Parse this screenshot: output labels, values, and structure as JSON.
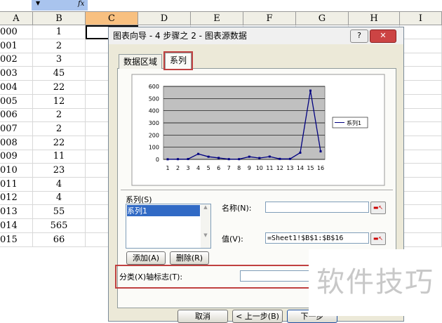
{
  "formula_bar": {
    "fx": "fx"
  },
  "columns": [
    "A",
    "B",
    "C",
    "D",
    "E",
    "F",
    "G",
    "H",
    "I"
  ],
  "rows": [
    [
      "000",
      "1"
    ],
    [
      "001",
      "2"
    ],
    [
      "002",
      "3"
    ],
    [
      "003",
      "45"
    ],
    [
      "004",
      "22"
    ],
    [
      "005",
      "12"
    ],
    [
      "006",
      "2"
    ],
    [
      "007",
      "2"
    ],
    [
      "008",
      "22"
    ],
    [
      "009",
      "11"
    ],
    [
      "010",
      "23"
    ],
    [
      "011",
      "4"
    ],
    [
      "012",
      "4"
    ],
    [
      "013",
      "55"
    ],
    [
      "014",
      "565"
    ],
    [
      "015",
      "66"
    ]
  ],
  "dialog": {
    "title": "图表向导 - 4 步骤之 2 - 图表源数据",
    "help": "?",
    "close": "✕",
    "tabs": [
      "数据区域",
      "系列"
    ],
    "series_label": "系列(S)",
    "series_items": [
      "系列1"
    ],
    "name_label": "名称(N):",
    "name_value": "",
    "value_label": "值(V):",
    "value_value": "=Sheet1!$B$1:$B$16",
    "add": "添加(A)",
    "delete": "删除(R)",
    "category_label": "分类(X)轴标志(T):",
    "category_value": "",
    "cancel": "取消",
    "back": "< 上一步(B)",
    "next": "下一步"
  },
  "chart_data": {
    "type": "line",
    "categories": [
      "1",
      "2",
      "3",
      "4",
      "5",
      "6",
      "7",
      "8",
      "9",
      "10",
      "11",
      "12",
      "13",
      "14",
      "15",
      "16"
    ],
    "series": [
      {
        "name": "系列1",
        "values": [
          1,
          2,
          3,
          45,
          22,
          12,
          2,
          2,
          22,
          11,
          23,
          4,
          4,
          55,
          565,
          66
        ]
      }
    ],
    "yticks": [
      "0",
      "100",
      "200",
      "300",
      "400",
      "500",
      "600"
    ],
    "ylim": [
      0,
      600
    ],
    "legend": "right",
    "line_color": "#000080",
    "plot_bg": "#c0c0c0"
  },
  "watermark": "软件技巧"
}
